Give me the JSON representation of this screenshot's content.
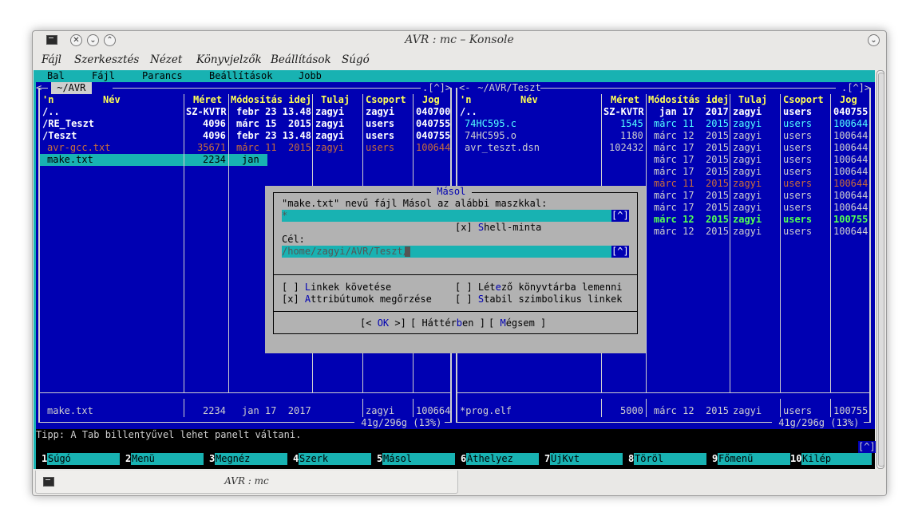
{
  "window": {
    "title": "AVR : mc – Konsole",
    "tab_title": "AVR : mc"
  },
  "menubar": [
    "Fájl",
    "Szerkesztés",
    "Nézet",
    "Könyvjelzők",
    "Beállítások",
    "Súgó"
  ],
  "mc_menu": [
    "Bal",
    "Fájl",
    "Parancs",
    "Beállítások",
    "Jobb"
  ],
  "left_panel": {
    "path": " ~/AVR ",
    "corner": ".[^]>",
    "columns": {
      "n": "'n",
      "name": "Név",
      "size": "Méret",
      "modified": "Módosítás idej",
      "owner": "Tulaj",
      "group": "Csoport",
      "perm": "Jog"
    },
    "rows": [
      {
        "name": "/..",
        "size": "SZ-KVTR",
        "date": "febr 23 13.48",
        "owner": "zagyi",
        "group": "zagyi",
        "perm": "040700"
      },
      {
        "name": "/RE_Teszt",
        "size": "4096",
        "date": "márc 15  2015",
        "owner": "zagyi",
        "group": "users",
        "perm": "040755"
      },
      {
        "name": "/Teszt",
        "size": "4096",
        "date": "febr 23 13.48",
        "owner": "zagyi",
        "group": "users",
        "perm": "040755"
      },
      {
        "name": "avr-gcc.txt",
        "size": "35671",
        "date": "márc 11  2015",
        "owner": "zagyi",
        "group": "users",
        "perm": "100644"
      },
      {
        "name": "make.txt",
        "size": "2234",
        "date": "jan"
      }
    ],
    "status": {
      "name": "make.txt",
      "size": "2234",
      "date": "jan 17  2017",
      "owner": "zagyi",
      "perm": "100664"
    },
    "free": " 41g/296g (13%) "
  },
  "right_panel": {
    "path": " ~/AVR/Teszt ",
    "prefix": "<-",
    "corner": ".[^]>",
    "columns": {
      "n": "'n",
      "name": "Név",
      "size": "Méret",
      "modified": "Módosítás idej",
      "owner": "Tulaj",
      "group": "Csoport",
      "perm": "Jog"
    },
    "rows": [
      {
        "name": "/..",
        "size": "SZ-KVTR",
        "date": "jan 17  2017",
        "owner": "zagyi",
        "group": "users",
        "perm": "040755"
      },
      {
        "name": "74HC595.c",
        "size": "1545",
        "date": "márc 11  2015",
        "owner": "zagyi",
        "group": "users",
        "perm": "100644"
      },
      {
        "name": "74HC595.o",
        "size": "1180",
        "date": "márc 12  2015",
        "owner": "zagyi",
        "group": "users",
        "perm": "100644"
      },
      {
        "name": "avr_teszt.dsn",
        "size": "102432",
        "date": "márc 17  2015",
        "owner": "zagyi",
        "group": "users",
        "perm": "100644"
      }
    ],
    "rows_extra": [
      {
        "date": "márc 17  2015",
        "owner": "zagyi",
        "group": "users",
        "perm": "100644"
      },
      {
        "date": "márc 17  2015",
        "owner": "zagyi",
        "group": "users",
        "perm": "100644"
      },
      {
        "date": "márc 11  2015",
        "owner": "zagyi",
        "group": "users",
        "perm": "100644"
      },
      {
        "date": "márc 17  2015",
        "owner": "zagyi",
        "group": "users",
        "perm": "100644"
      },
      {
        "date": "márc 17  2015",
        "owner": "zagyi",
        "group": "users",
        "perm": "100644"
      },
      {
        "date": "márc 12  2015",
        "owner": "zagyi",
        "group": "users",
        "perm": "100755"
      },
      {
        "date": "márc 12  2015",
        "owner": "zagyi",
        "group": "users",
        "perm": "100644"
      }
    ],
    "status": {
      "name": "*prog.elf",
      "size": "5000",
      "date": "márc 12  2015",
      "owner": "zagyi",
      "group": "users",
      "perm": "100755"
    },
    "free": " 41g/296g (13%) "
  },
  "dialog": {
    "title": " Másol ",
    "prompt": "\"make.txt\" nevű fájl Másol az alábbi maszkkal:",
    "mask_value": "*",
    "history_btn": "[^]",
    "shell_pattern_box": "[x] ",
    "shell_pattern_hot": "S",
    "shell_pattern_rest": "hell-minta",
    "target_label": "Cél:",
    "target_value": "/home/zagyi/AVR/Teszt/",
    "opt_links_box": "[ ] ",
    "opt_links_hot": "L",
    "opt_links_rest": "inkek követése",
    "opt_attr_box": "[x] ",
    "opt_attr_hot": "A",
    "opt_attr_rest": "ttribútumok megőrzése",
    "opt_dive_box": "[ ] Lét",
    "opt_dive_hot": "e",
    "opt_dive_rest": "ző könyvtárba lemenni",
    "opt_stable_box": "[ ] ",
    "opt_stable_hot": "S",
    "opt_stable_rest": "tabil szimbolikus linkek",
    "btn_ok_pre": "[< ",
    "btn_ok_hot": "OK",
    "btn_ok_post": " >]",
    "btn_bg_pre": "[ Háttér",
    "btn_bg_hot": "b",
    "btn_bg_post": "en ]",
    "btn_cancel_pre": "[ ",
    "btn_cancel_hot": "M",
    "btn_cancel_post": "égsem ]"
  },
  "hint": "Tipp: A Tab billentyűvel lehet panelt váltani.",
  "hint_btn": "[^]",
  "fkeys": [
    {
      "n": "1",
      "label": "Súgó"
    },
    {
      "n": "2",
      "label": "Menü"
    },
    {
      "n": "3",
      "label": "Megnéz"
    },
    {
      "n": "4",
      "label": "Szerk"
    },
    {
      "n": "5",
      "label": "Másol"
    },
    {
      "n": "6",
      "label": "Áthelyez"
    },
    {
      "n": "7",
      "label": "ÚjKvt"
    },
    {
      "n": "8",
      "label": "Töröl"
    },
    {
      "n": "9",
      "label": "Főmenü"
    },
    {
      "n": "10",
      "label": "Kilép"
    }
  ],
  "colors": {
    "mc_blue": "#0000b2",
    "mc_cyan": "#18b2b2",
    "dialog_gray": "#b2b2b2"
  }
}
